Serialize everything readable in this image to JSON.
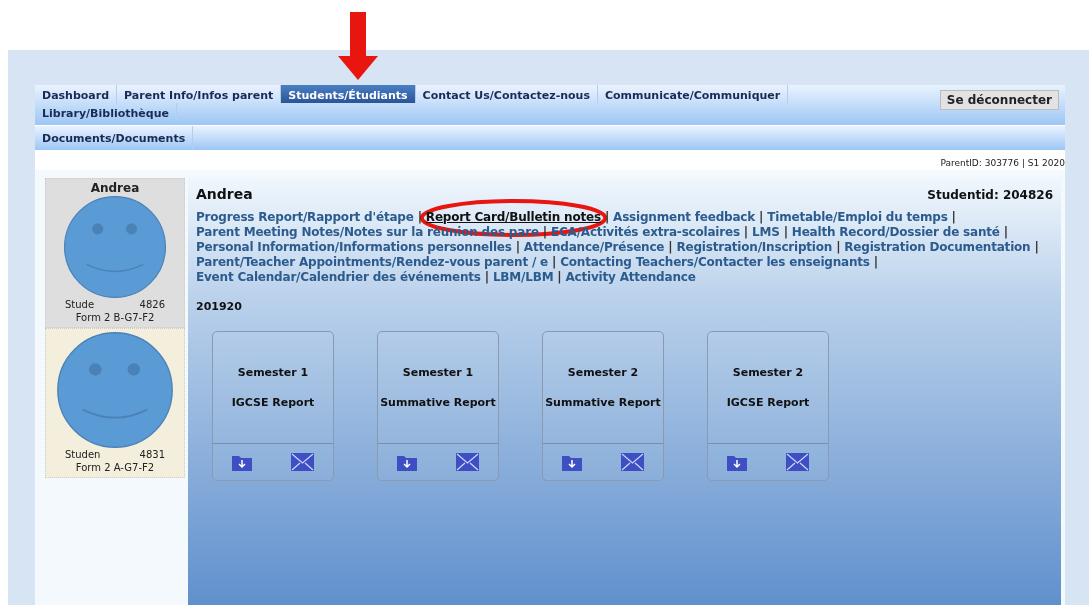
{
  "nav": {
    "tabs": [
      {
        "label": "Dashboard",
        "selected": false
      },
      {
        "label": "Parent Info/Infos parent",
        "selected": false
      },
      {
        "label": "Students/Étudiants",
        "selected": true
      },
      {
        "label": "Contact Us/Contactez-nous",
        "selected": false
      },
      {
        "label": "Communicate/Communiquer",
        "selected": false
      },
      {
        "label": "Library/Bibliothèque",
        "selected": false
      }
    ],
    "logout": "Se déconnecter",
    "subtabs": [
      {
        "label": "Documents/Documents",
        "selected": false
      }
    ]
  },
  "parent_info": "ParentID: 303776 | S1 2020",
  "students": [
    {
      "name": "Andrea",
      "id_start": "Stude",
      "id_end": "4826",
      "form": "Form 2 B-G7-F2",
      "selected": true
    },
    {
      "id_start": "Studen",
      "id_end": "4831",
      "form": "Form 2 A-G7-F2",
      "selected": false
    }
  ],
  "student": {
    "name": "Andrea",
    "studentid": "Studentid: 204826"
  },
  "separator": "|",
  "links": [
    {
      "label": "Progress Report/Rapport d'étape",
      "selected": false
    },
    {
      "label": "Report Card/Bulletin notes",
      "selected": true
    },
    {
      "label": "Assignment feedback",
      "selected": false
    },
    {
      "label": "Timetable/Emploi du temps",
      "selected": false
    },
    {
      "label": "Parent Meeting Notes/Notes sur la réunion des pare",
      "selected": false
    },
    {
      "label": "ECA/Activités extra-scolaires",
      "selected": false
    },
    {
      "label": "LMS",
      "selected": false
    },
    {
      "label": "Health Record/Dossier de santé",
      "selected": false
    },
    {
      "label": "Personal Information/Informations personnelles",
      "selected": false
    },
    {
      "label": "Attendance/Présence",
      "selected": false
    },
    {
      "label": "Registration/Inscription",
      "selected": false
    },
    {
      "label": "Registration Documentation",
      "selected": false
    },
    {
      "label": "Parent/Teacher Appointments/Rendez-vous parent / e",
      "selected": false
    },
    {
      "label": "Contacting Teachers/Contacter les enseignants",
      "selected": false
    },
    {
      "label": "Event Calendar/Calendrier des événements",
      "selected": false
    },
    {
      "label": "LBM/LBM",
      "selected": false
    },
    {
      "label": "Activity Attendance",
      "selected": false
    }
  ],
  "year": "201920",
  "reports": [
    {
      "term": "Semester 1",
      "title": "IGCSE Report"
    },
    {
      "term": "Semester 1",
      "title": "Summative Report"
    },
    {
      "term": "Semester 2",
      "title": "Summative Report"
    },
    {
      "term": "Semester 2",
      "title": "IGCSE Report"
    }
  ]
}
